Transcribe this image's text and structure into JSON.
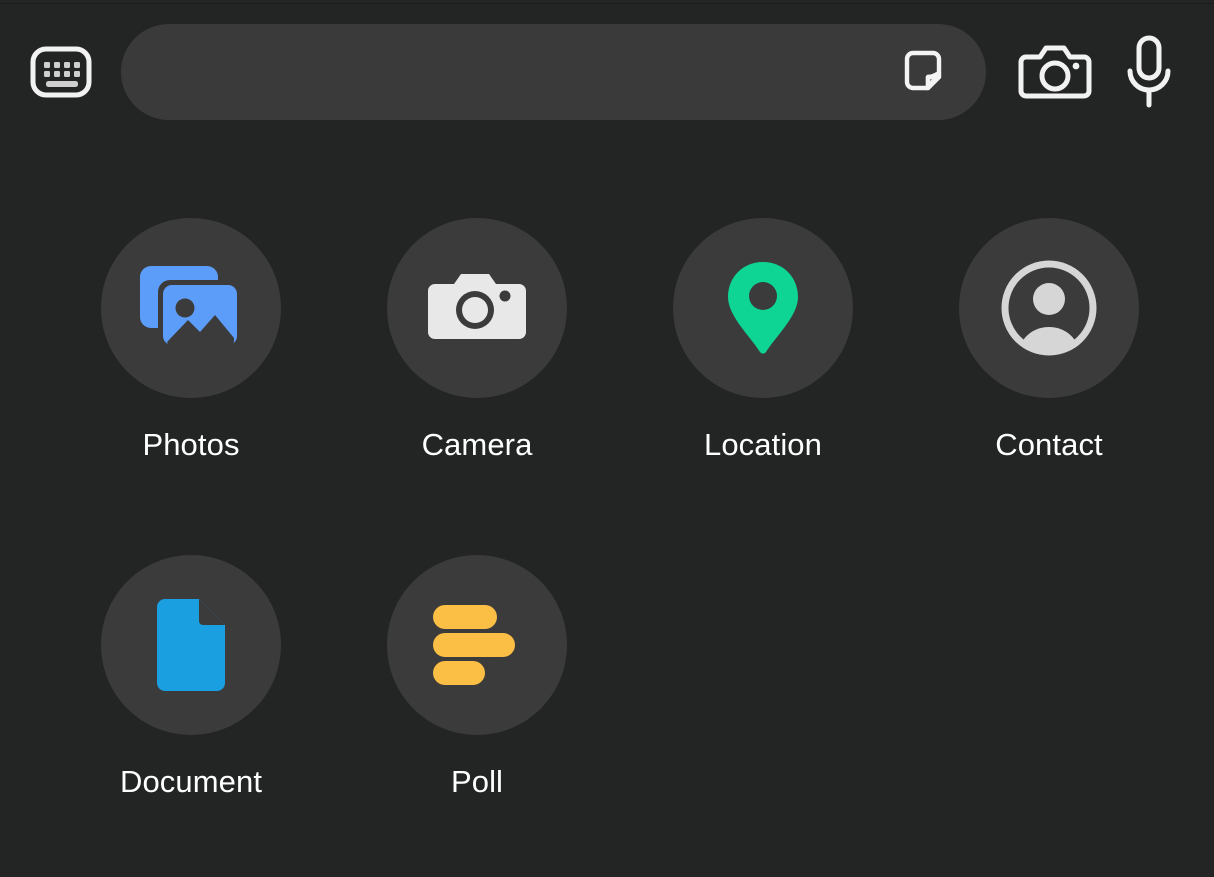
{
  "theme": {
    "background": "#232525",
    "field_background": "#3a3a3a",
    "circle_background": "#3b3b3b",
    "label_color": "#ffffff",
    "icon_white": "#ededed",
    "photos_blue": "#5b9df9",
    "document_blue": "#1a9fe0",
    "location_green": "#0ed494",
    "poll_orange": "#fbbf45",
    "contact_gray": "#d6d6d6"
  },
  "input_bar": {
    "keyboard_button": {
      "icon": "keyboard-icon",
      "label": "Keyboard"
    },
    "text_field": {
      "value": "",
      "placeholder": ""
    },
    "sticker_button": {
      "icon": "sticker-icon",
      "label": "Stickers"
    },
    "camera_button": {
      "icon": "camera-icon",
      "label": "Camera"
    },
    "mic_button": {
      "icon": "microphone-icon",
      "label": "Voice message"
    }
  },
  "attachment_grid": {
    "items": [
      {
        "id": "photos",
        "label": "Photos",
        "icon": "photos-icon"
      },
      {
        "id": "camera",
        "label": "Camera",
        "icon": "camera-icon"
      },
      {
        "id": "location",
        "label": "Location",
        "icon": "location-pin-icon"
      },
      {
        "id": "contact",
        "label": "Contact",
        "icon": "contact-person-icon"
      },
      {
        "id": "document",
        "label": "Document",
        "icon": "document-icon"
      },
      {
        "id": "poll",
        "label": "Poll",
        "icon": "poll-bars-icon"
      }
    ]
  }
}
